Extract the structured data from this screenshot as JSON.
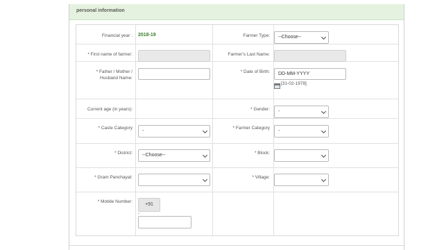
{
  "section": {
    "title": "personal information"
  },
  "rows": {
    "financial_year": {
      "label": "Financial year :",
      "value": "2018-19"
    },
    "farmer_type": {
      "label": "Farmer Type:",
      "value": "--Choose--"
    },
    "first_name": {
      "label": "* First name of farmer:",
      "value": ""
    },
    "last_name": {
      "label": "Farmer's Last Name:",
      "value": ""
    },
    "relative_name": {
      "label_line1": "* Father / Mother /",
      "label_line2": "Husband Name:",
      "value": ""
    },
    "dob": {
      "label": "* Date of Birth:",
      "placeholder": "DD-MM-YYYY",
      "example": "[31-02-1978]"
    },
    "current_age": {
      "label": "Current age (in years):"
    },
    "gender": {
      "label": "* Gender:",
      "value": "-"
    },
    "caste": {
      "label": "* Caste Category",
      "value": "-"
    },
    "farmer_category": {
      "label": "* Farmer Category",
      "value": "-"
    },
    "district": {
      "label": "* District:",
      "value": "--Choose--"
    },
    "block": {
      "label": "* Block:",
      "value": ""
    },
    "gram_panchayat": {
      "label": "* Gram Panchayat:",
      "value": ""
    },
    "village": {
      "label": "* Village:",
      "value": ""
    },
    "mobile": {
      "label": "* Mobile Number:",
      "prefix": "+91",
      "dash": "-",
      "value": ""
    }
  },
  "icons": {
    "calendar": "calendar-icon",
    "dropdown": "chevron-down-icon"
  },
  "colors": {
    "header_bg": "#e6f2e0",
    "value_green": "#3a7d2c"
  }
}
